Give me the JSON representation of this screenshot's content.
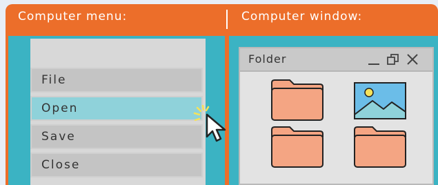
{
  "header": {
    "left_title": "Computer menu:",
    "right_title": "Computer window:"
  },
  "menu": {
    "items": [
      {
        "label": "File",
        "state": "normal"
      },
      {
        "label": "Open",
        "state": "highlighted"
      },
      {
        "label": "Save",
        "state": "normal"
      },
      {
        "label": "Close",
        "state": "normal"
      }
    ]
  },
  "window": {
    "title": "Folder",
    "controls": [
      "minimize-icon",
      "restore-icon",
      "close-icon"
    ],
    "items": [
      "folder-icon",
      "image-file-icon",
      "folder-icon",
      "folder-icon"
    ]
  },
  "colors": {
    "frame": "#ec6e2a",
    "panel": "#3bb3c3",
    "highlight": "#8fd2da",
    "folder": "#f4a583"
  }
}
